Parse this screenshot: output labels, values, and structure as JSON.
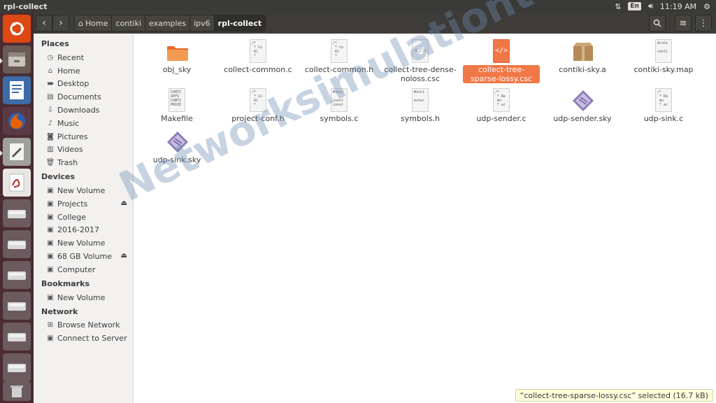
{
  "window": {
    "title": "rpl-collect"
  },
  "panel": {
    "keyboard": "En",
    "time": "11:19 AM"
  },
  "breadcrumb": [
    "Home",
    "contiki",
    "examples",
    "ipv6",
    "rpl-collect"
  ],
  "sidebar": {
    "places_title": "Places",
    "places": [
      {
        "label": "Recent",
        "icon": "clock-icon"
      },
      {
        "label": "Home",
        "icon": "home-icon"
      },
      {
        "label": "Desktop",
        "icon": "folder-icon"
      },
      {
        "label": "Documents",
        "icon": "document-icon"
      },
      {
        "label": "Downloads",
        "icon": "download-icon"
      },
      {
        "label": "Music",
        "icon": "music-icon"
      },
      {
        "label": "Pictures",
        "icon": "camera-icon"
      },
      {
        "label": "Videos",
        "icon": "film-icon"
      },
      {
        "label": "Trash",
        "icon": "trash-icon"
      }
    ],
    "devices_title": "Devices",
    "devices": [
      {
        "label": "New Volume"
      },
      {
        "label": "Projects"
      },
      {
        "label": "College"
      },
      {
        "label": "2016-2017"
      },
      {
        "label": "New Volume"
      },
      {
        "label": "68 GB Volume"
      },
      {
        "label": "Computer"
      }
    ],
    "bookmarks_title": "Bookmarks",
    "bookmarks": [
      {
        "label": "New Volume"
      }
    ],
    "network_title": "Network",
    "network": [
      {
        "label": "Browse Network"
      },
      {
        "label": "Connect to Server"
      }
    ]
  },
  "files": [
    {
      "name": "obj_sky",
      "type": "folder"
    },
    {
      "name": "collect-common.c",
      "type": "c",
      "preview": "/*\n * Co\n Al\n *"
    },
    {
      "name": "collect-common.h",
      "type": "c",
      "preview": "/*\n * Co\n Al\n *"
    },
    {
      "name": "collect-tree-dense-noloss.csc",
      "type": "xml"
    },
    {
      "name": "collect-tree-sparse-lossy.csc",
      "type": "xml",
      "selected": true
    },
    {
      "name": "contiki-sky.a",
      "type": "archive"
    },
    {
      "name": "contiki-sky.map",
      "type": "text",
      "preview": "Archi\n\nconti"
    },
    {
      "name": "Makefile",
      "type": "text",
      "preview": "CONTI\nAPPS\nCONTI\nPROJE"
    },
    {
      "name": "project-conf.h",
      "type": "c",
      "preview": "/*\n * Co\n Al\n *"
    },
    {
      "name": "symbols.c",
      "type": "c",
      "preview": "#incl\n\nconst\nconst"
    },
    {
      "name": "symbols.h",
      "type": "c",
      "preview": "#incl\n\nexter"
    },
    {
      "name": "udp-sender.c",
      "type": "c",
      "preview": "/*\n * Re\n mo\n * ar"
    },
    {
      "name": "udp-sender.sky",
      "type": "sky"
    },
    {
      "name": "udp-sink.c",
      "type": "c",
      "preview": "/*\n * Re\n mo\n * ar"
    },
    {
      "name": "udp-sink.sky",
      "type": "sky"
    }
  ],
  "watermark": "Networksimulationtools.com",
  "status": "“collect-tree-sparse-lossy.csc” selected  (16.7 kB)",
  "colors": {
    "accent": "#f07746",
    "launcher": "#4b2c33",
    "toolbar": "#3d3c38"
  }
}
